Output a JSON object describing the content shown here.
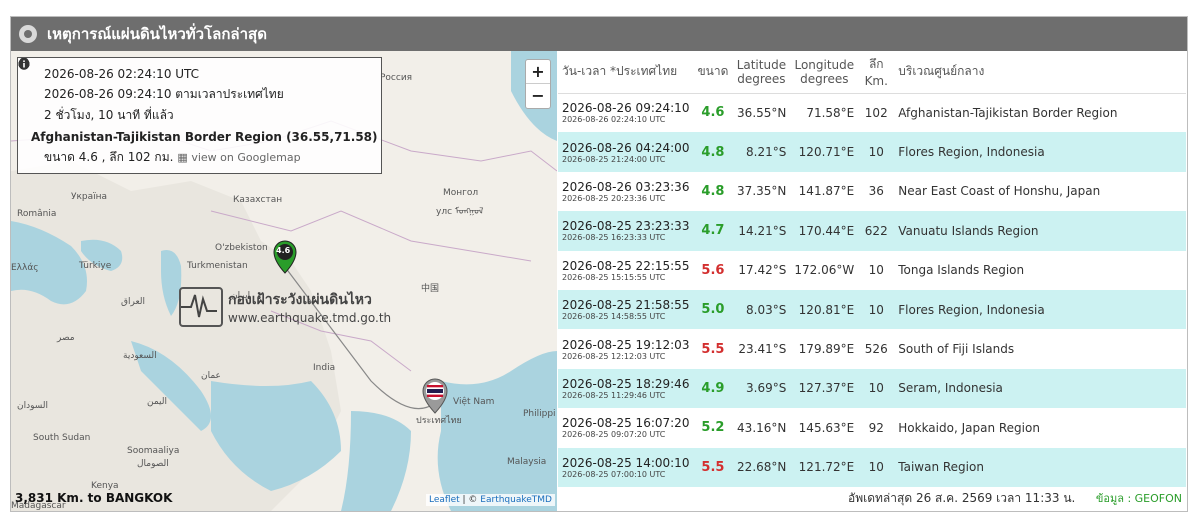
{
  "header": {
    "title": "เหตุการณ์แผ่นดินไหวทั่วโลกล่าสุด"
  },
  "info": {
    "utc": "2026-08-26 02:24:10 UTC",
    "local": "2026-08-26 09:24:10 ตามเวลาประเทศไทย",
    "ago": "2 ชั่วโมง, 10 นาที ที่แล้ว",
    "region": "Afghanistan-Tajikistan Border Region (36.55,71.58)",
    "mag_depth": "ขนาด 4.6 , ลึก 102 กม.",
    "gmap": "view on Googlemap"
  },
  "map": {
    "zoom_in": "+",
    "zoom_out": "−",
    "marker_mag": "4.6",
    "watermark_title": "กองเฝ้าระวังแผ่นดินไหว",
    "watermark_url": "www.earthquake.tmd.go.th",
    "distance": "3,831 Km. to BANGKOK",
    "attribution_leaflet": "Leaflet",
    "attribution_sep": " | © ",
    "attribution_tmd": "EarthquakeTMD",
    "labels": [
      "Россия",
      "Україна",
      "România",
      "Казахстан",
      "Монгол",
      "улс ᠮᠣᠩᠭᠣᠯ",
      "O'zbekiston",
      "Türkiye",
      "Ελλάς",
      "Turkmenistan",
      "中国",
      "العراق",
      "ایران",
      "مصر",
      "السعودية",
      "India",
      "عمان",
      "ประเทศไทย",
      "Việt Nam",
      "Philippi",
      "السودان",
      "اليمن",
      "South Sudan",
      "Soomaaliya",
      "الصومال",
      "Malaysia",
      "Kenya",
      "Madagascar"
    ]
  },
  "table": {
    "headers": {
      "datetime": "วัน-เวลา *ประเทศไทย",
      "mag": "ขนาด",
      "lat1": "Latitude",
      "lat2": "degrees",
      "lon1": "Longitude",
      "lon2": "degrees",
      "depth1": "ลึก",
      "depth2": "Km.",
      "region": "บริเวณศูนย์กลาง"
    },
    "rows": [
      {
        "local": "2026-08-26 09:24:10",
        "utc": "2026-08-26 02:24:10 UTC",
        "mag": "4.6",
        "lat": "36.55°N",
        "lon": "71.58°E",
        "depth": "102",
        "region": "Afghanistan-Tajikistan Border Region"
      },
      {
        "local": "2026-08-26 04:24:00",
        "utc": "2026-08-25 21:24:00 UTC",
        "mag": "4.8",
        "lat": "8.21°S",
        "lon": "120.71°E",
        "depth": "10",
        "region": "Flores Region, Indonesia"
      },
      {
        "local": "2026-08-26 03:23:36",
        "utc": "2026-08-25 20:23:36 UTC",
        "mag": "4.8",
        "lat": "37.35°N",
        "lon": "141.87°E",
        "depth": "36",
        "region": "Near East Coast of Honshu, Japan"
      },
      {
        "local": "2026-08-25 23:23:33",
        "utc": "2026-08-25 16:23:33 UTC",
        "mag": "4.7",
        "lat": "14.21°S",
        "lon": "170.44°E",
        "depth": "622",
        "region": "Vanuatu Islands Region"
      },
      {
        "local": "2026-08-25 22:15:55",
        "utc": "2026-08-25 15:15:55 UTC",
        "mag": "5.6",
        "lat": "17.42°S",
        "lon": "172.06°W",
        "depth": "10",
        "region": "Tonga Islands Region"
      },
      {
        "local": "2026-08-25 21:58:55",
        "utc": "2026-08-25 14:58:55 UTC",
        "mag": "5.0",
        "lat": "8.03°S",
        "lon": "120.81°E",
        "depth": "10",
        "region": "Flores Region, Indonesia"
      },
      {
        "local": "2026-08-25 19:12:03",
        "utc": "2026-08-25 12:12:03 UTC",
        "mag": "5.5",
        "lat": "23.41°S",
        "lon": "179.89°E",
        "depth": "526",
        "region": "South of Fiji Islands"
      },
      {
        "local": "2026-08-25 18:29:46",
        "utc": "2026-08-25 11:29:46 UTC",
        "mag": "4.9",
        "lat": "3.69°S",
        "lon": "127.37°E",
        "depth": "10",
        "region": "Seram, Indonesia"
      },
      {
        "local": "2026-08-25 16:07:20",
        "utc": "2026-08-25 09:07:20 UTC",
        "mag": "5.2",
        "lat": "43.16°N",
        "lon": "145.63°E",
        "depth": "92",
        "region": "Hokkaido, Japan Region"
      },
      {
        "local": "2026-08-25 14:00:10",
        "utc": "2026-08-25 07:00:10 UTC",
        "mag": "5.5",
        "lat": "22.68°N",
        "lon": "121.72°E",
        "depth": "10",
        "region": "Taiwan Region"
      }
    ]
  },
  "footer": {
    "updated": "อัพเดทล่าสุด 26 ส.ค. 2569 เวลา 11:33 น.",
    "source": "ข้อมูล : GEOFON"
  },
  "colors": {
    "mag_green": "#2a9d2a",
    "mag_red": "#d32f2f",
    "row_alt": "#ccf2f2",
    "header_bg": "#6e6e6e"
  }
}
